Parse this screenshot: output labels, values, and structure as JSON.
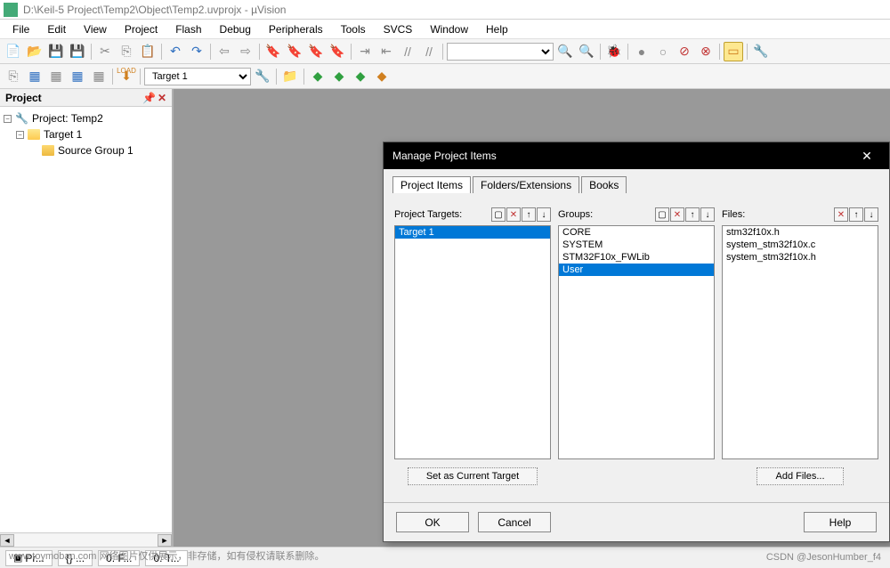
{
  "title": "D:\\Keil-5 Project\\Temp2\\Object\\Temp2.uvprojx - µVision",
  "menu": [
    "File",
    "Edit",
    "View",
    "Project",
    "Flash",
    "Debug",
    "Peripherals",
    "Tools",
    "SVCS",
    "Window",
    "Help"
  ],
  "target_combo": "Target 1",
  "project_panel": {
    "title": "Project",
    "tree": {
      "root": "Project: Temp2",
      "target": "Target 1",
      "group": "Source Group 1"
    }
  },
  "status_tabs": [
    "Pr...",
    "{} ...",
    "0. F...",
    "0. T..."
  ],
  "dialog": {
    "title": "Manage Project Items",
    "tabs": [
      "Project Items",
      "Folders/Extensions",
      "Books"
    ],
    "targets_label": "Project Targets:",
    "groups_label": "Groups:",
    "files_label": "Files:",
    "targets": [
      "Target 1"
    ],
    "groups": [
      "CORE",
      "SYSTEM",
      "STM32F10x_FWLib",
      "User"
    ],
    "groups_selected": 3,
    "files": [
      "stm32f10x.h",
      "system_stm32f10x.c",
      "system_stm32f10x.h"
    ],
    "set_current_btn": "Set as Current Target",
    "add_files_btn": "Add Files...",
    "ok_btn": "OK",
    "cancel_btn": "Cancel",
    "help_btn": "Help"
  },
  "watermark": "www.toymoban.com 网络图片仅供展示，非存储，如有侵权请联系删除。",
  "watermark2": "CSDN @JesonHumber_f4"
}
